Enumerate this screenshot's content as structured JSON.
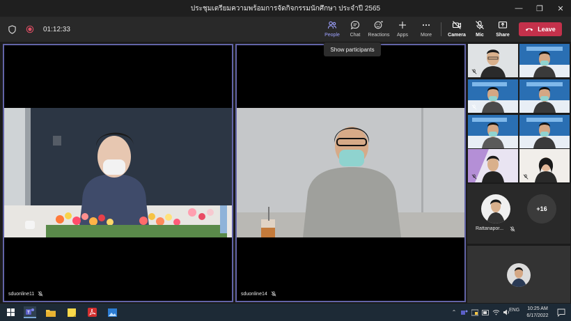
{
  "window": {
    "title": "ประชุมเตรียมความพร้อมการจัดกิจกรรมนักศึกษา ประจำปี 2565",
    "minimize": "—",
    "maximize": "❐",
    "close": "✕"
  },
  "toolbar": {
    "timer": "01:12:33",
    "people_label": "People",
    "chat_label": "Chat",
    "reactions_label": "Reactions",
    "apps_label": "Apps",
    "more_label": "More",
    "camera_label": "Camera",
    "mic_label": "Mic",
    "share_label": "Share",
    "leave_label": "Leave"
  },
  "tooltip": {
    "text": "Show participants"
  },
  "tiles": [
    {
      "name": "sduonline11"
    },
    {
      "name": "sduonline14"
    }
  ],
  "sidebar": {
    "avatar_name": "Rattanapor...",
    "more_count": "+16"
  },
  "taskbar": {
    "lang": "ENG",
    "time": "10:25 AM",
    "date": "6/17/2022"
  },
  "colors": {
    "accent": "#6264a7",
    "leave": "#c4314b",
    "toolbar": "#292929"
  }
}
